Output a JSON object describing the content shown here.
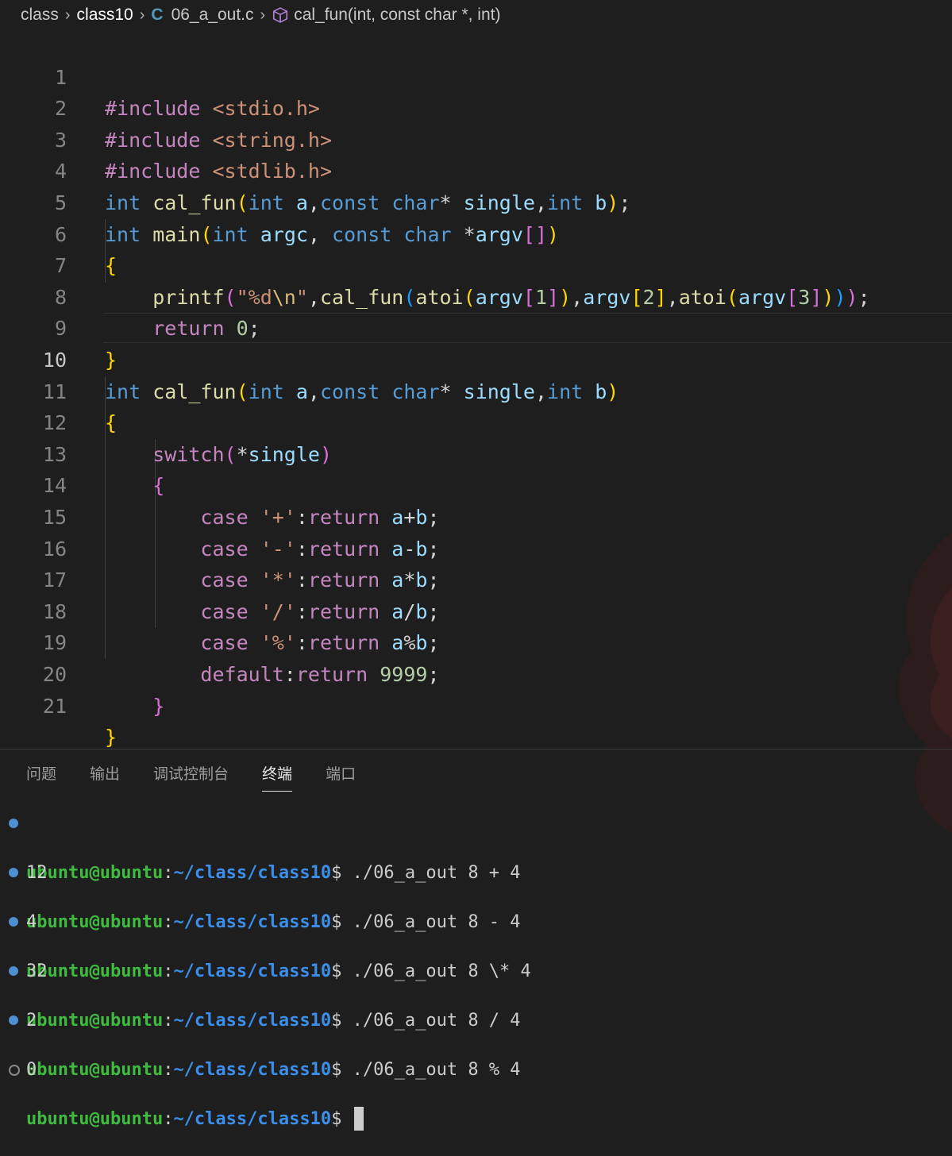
{
  "breadcrumb": {
    "items": [
      "class",
      "class10",
      "06_a_out.c",
      "cal_fun(int, const char *, int)"
    ],
    "file_icon": "C"
  },
  "editor": {
    "current_line": 10,
    "line_numbers": [
      "1",
      "2",
      "3",
      "4",
      "5",
      "6",
      "7",
      "8",
      "9",
      "10",
      "11",
      "12",
      "13",
      "14",
      "15",
      "16",
      "17",
      "18",
      "19",
      "20",
      "21"
    ],
    "lines": [
      "#include <stdio.h>",
      "#include <string.h>",
      "#include <stdlib.h>",
      "int cal_fun(int a,const char* single,int b);",
      "int main(int argc, const char *argv[])",
      "{",
      "    printf(\"%d\\n\",cal_fun(atoi(argv[1]),argv[2],atoi(argv[3])));",
      "    return 0;",
      "}",
      "int cal_fun(int a,const char* single,int b)",
      "{",
      "    switch(*single)",
      "    {",
      "        case '+':return a+b;",
      "        case '-':return a-b;",
      "        case '*':return a*b;",
      "        case '/':return a/b;",
      "        case '%':return a%b;",
      "        default:return 9999;",
      "    }",
      "}"
    ]
  },
  "panel": {
    "tabs": [
      "问题",
      "输出",
      "调试控制台",
      "终端",
      "端口"
    ],
    "active_tab": "终端"
  },
  "terminal": {
    "user": "ubuntu@ubuntu",
    "path": "~/class/class10",
    "prompt_symbol": "$",
    "sessions": [
      {
        "command": "./06_a_out 8 + 4",
        "output": "12"
      },
      {
        "command": "./06_a_out 8 - 4",
        "output": "4"
      },
      {
        "command": "./06_a_out 8 \\* 4",
        "output": "32"
      },
      {
        "command": "./06_a_out 8 / 4",
        "output": "2"
      },
      {
        "command": "./06_a_out 8 % 4",
        "output": "0"
      }
    ]
  },
  "colors": {
    "background": "#1e1e1e",
    "keyword": "#569cd6",
    "control": "#c586c0",
    "function": "#dcdcaa",
    "variable": "#9cdcfe",
    "string": "#ce9178",
    "number": "#b5cea8",
    "terminal_user": "#3fbb3f",
    "terminal_path": "#3b8eea"
  }
}
